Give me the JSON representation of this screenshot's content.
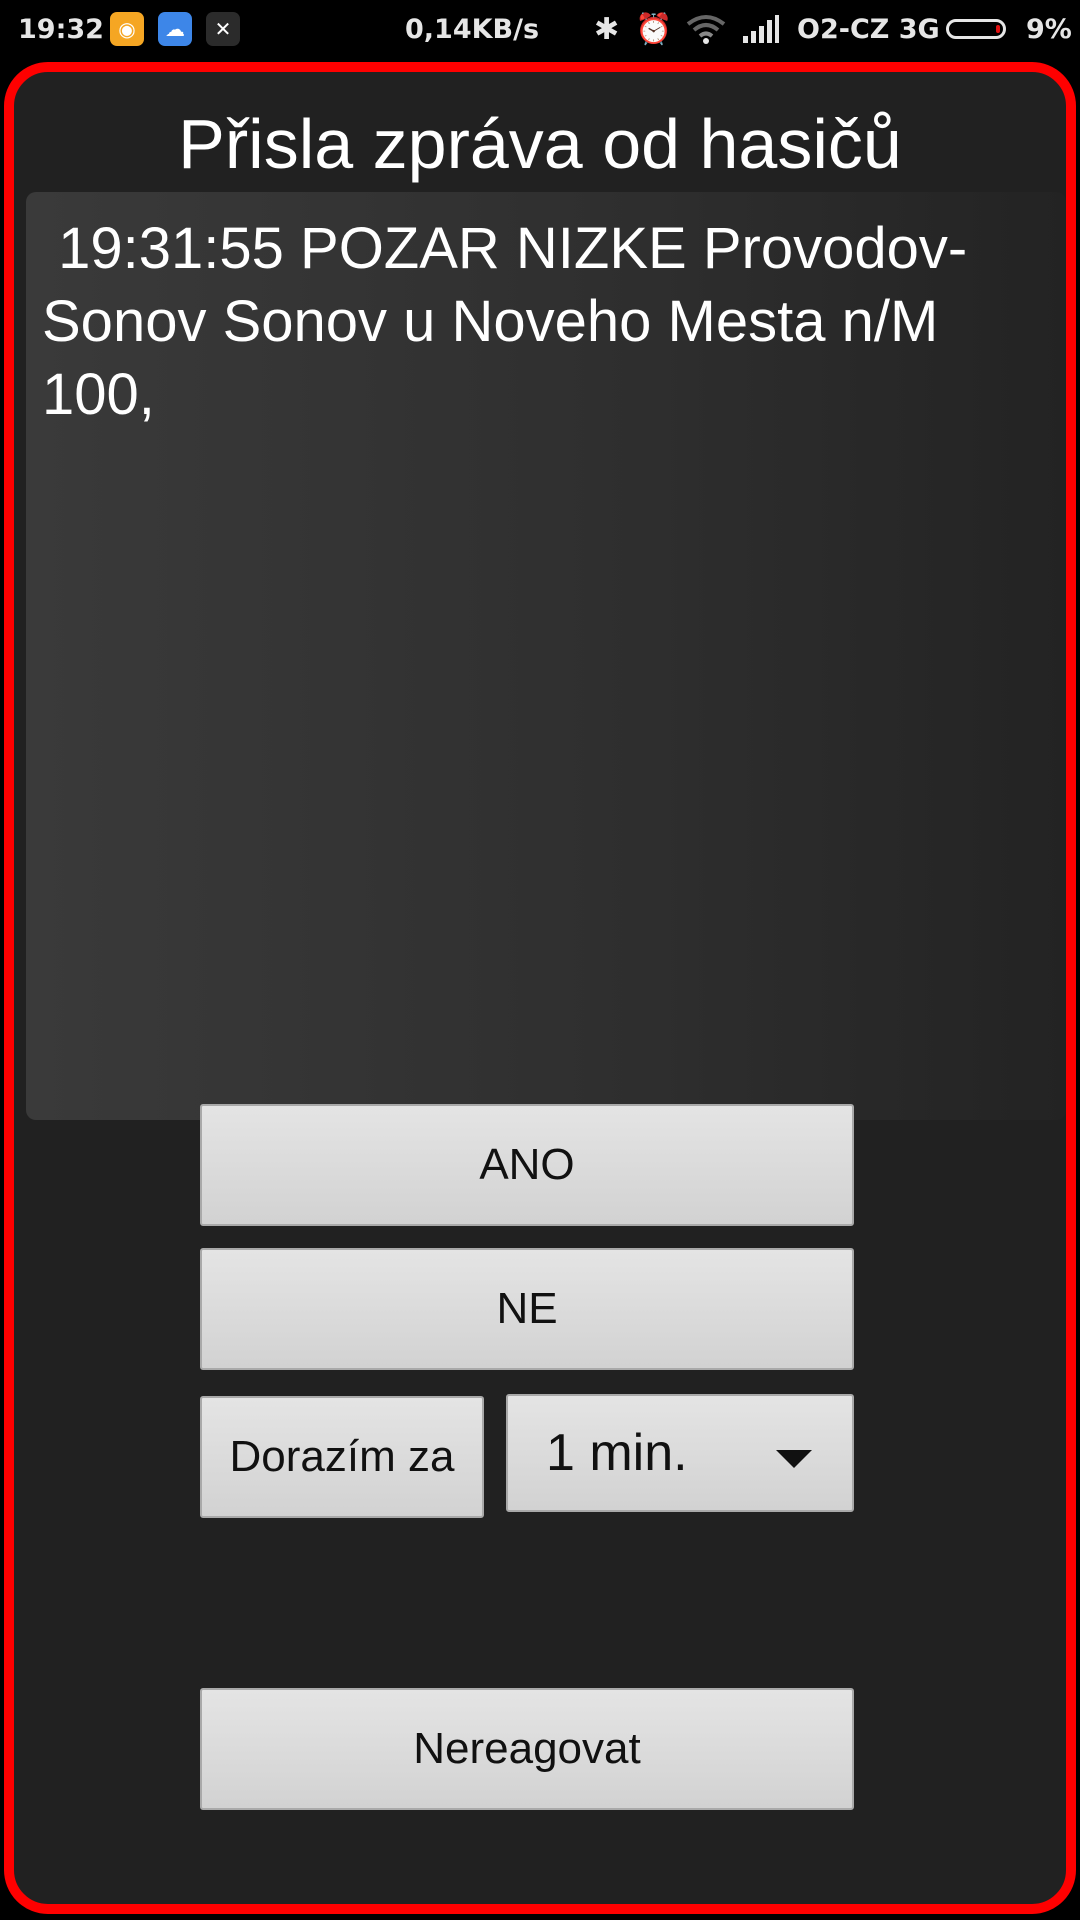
{
  "status_bar": {
    "time": "19:32",
    "network_speed": "0,14KB/s",
    "carrier": "O2-CZ 3G",
    "battery_percent": "9%",
    "battery_level": 0.09,
    "icons": [
      "chat-app-icon",
      "cloud-app-icon",
      "tools-app-icon",
      "bluetooth-icon",
      "alarm-icon",
      "wifi-icon",
      "signal-icon",
      "battery-icon"
    ]
  },
  "alert": {
    "border_color": "#ff0000",
    "title": "Přisla zpráva od hasičů",
    "message": " 19:31:55 POZAR NIZKE Provodov-Sonov Sonov u Noveho Mesta n/M 100,"
  },
  "actions": {
    "yes_label": "ANO",
    "no_label": "NE",
    "arrive_in_label": "Dorazím za",
    "arrive_minutes_selected": "1 min.",
    "no_response_label": "Nereagovat"
  }
}
